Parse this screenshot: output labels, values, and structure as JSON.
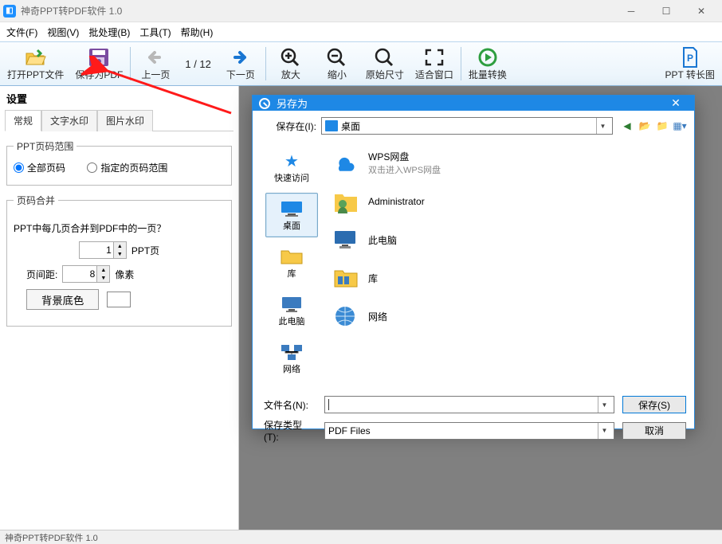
{
  "app": {
    "title": "神奇PPT转PDF软件 1.0"
  },
  "menu": {
    "file": "文件(F)",
    "view": "视图(V)",
    "batch": "批处理(B)",
    "tools": "工具(T)",
    "help": "帮助(H)"
  },
  "toolbar": {
    "open": "打开PPT文件",
    "save_pdf": "保存为PDF",
    "prev": "上一页",
    "next": "下一页",
    "page_counter": "1 / 12",
    "zoom_in": "放大",
    "zoom_out": "缩小",
    "original": "原始尺寸",
    "fit": "适合窗口",
    "batch": "批量转换",
    "long_image": "PPT 转长图"
  },
  "settings": {
    "heading": "设置",
    "tabs": {
      "general": "常规",
      "text_wm": "文字水印",
      "image_wm": "图片水印"
    },
    "range": {
      "legend": "PPT页码范围",
      "all": "全部页码",
      "specified": "指定的页码范围",
      "selected": "all"
    },
    "merge": {
      "legend": "页码合并",
      "question": "PPT中每几页合并到PDF中的一页？",
      "count": "1",
      "count_suffix": "PPT页",
      "spacing_label": "页间距:",
      "spacing": "8",
      "spacing_suffix": "像素",
      "bg_btn": "背景底色"
    }
  },
  "dialog": {
    "title": "另存为",
    "save_in_label": "保存在(I):",
    "save_in_value": "桌面",
    "nav": {
      "quick": "快速访问",
      "desktop": "桌面",
      "libraries": "库",
      "this_pc": "此电脑",
      "network": "网络"
    },
    "items": [
      {
        "name": "WPS网盘",
        "sub": "双击进入WPS网盘",
        "icon": "cloud"
      },
      {
        "name": "Administrator",
        "icon": "user"
      },
      {
        "name": "此电脑",
        "icon": "pc"
      },
      {
        "name": "库",
        "icon": "folder"
      },
      {
        "name": "网络",
        "icon": "globe"
      }
    ],
    "filename_label": "文件名(N):",
    "filename_value": "",
    "filetype_label": "保存类型(T):",
    "filetype_value": "PDF Files",
    "save_btn": "保存(S)",
    "cancel_btn": "取消"
  },
  "status": {
    "text": "神奇PPT转PDF软件 1.0"
  }
}
